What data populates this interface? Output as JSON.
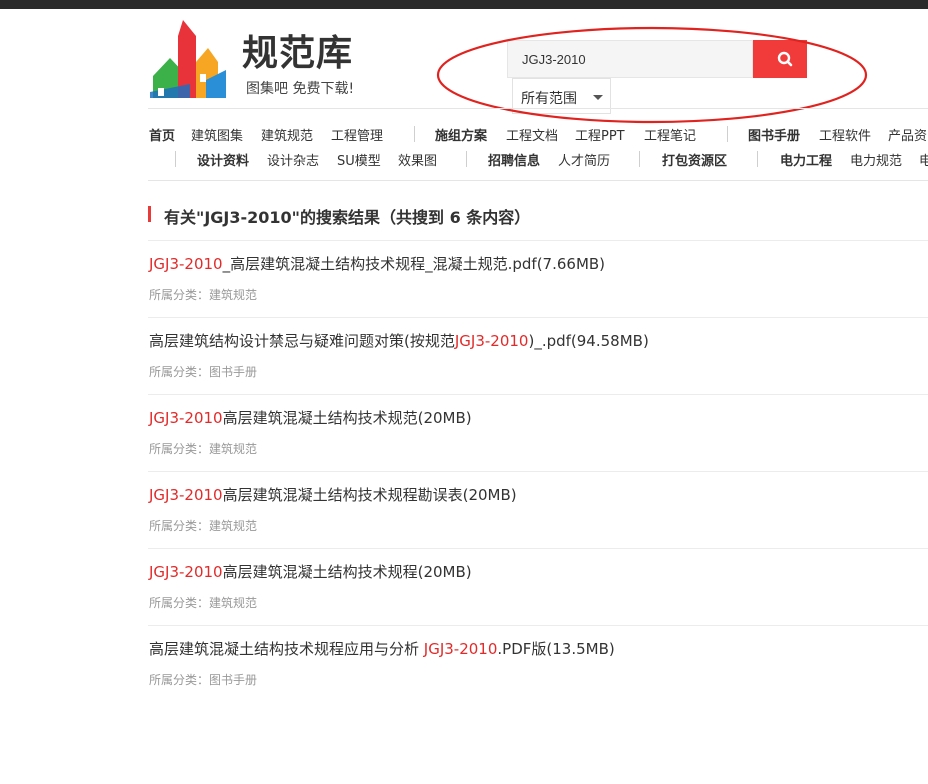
{
  "site": {
    "title": "规范库",
    "slogan": "图集吧 免费下载!"
  },
  "search": {
    "value": "JGJ3-2010",
    "placeholder": "",
    "button_icon": "search-icon",
    "scope_label": "所有范围",
    "accent_color": "#f13a3a"
  },
  "nav": {
    "row1": [
      {
        "label": "首页",
        "bold": true
      },
      {
        "label": "建筑图集",
        "bold": false
      },
      {
        "label": "建筑规范",
        "bold": false
      },
      {
        "label": "工程管理",
        "bold": false
      },
      {
        "label": "施组方案",
        "bold": true
      },
      {
        "label": "工程文档",
        "bold": false
      },
      {
        "label": "工程PPT",
        "bold": false
      },
      {
        "label": "工程笔记",
        "bold": false
      },
      {
        "label": "图书手册",
        "bold": true
      },
      {
        "label": "工程软件",
        "bold": false
      },
      {
        "label": "产品资",
        "bold": false
      }
    ],
    "row2": [
      {
        "label": "设计资料",
        "bold": true
      },
      {
        "label": "设计杂志",
        "bold": false
      },
      {
        "label": "SU模型",
        "bold": false
      },
      {
        "label": "效果图",
        "bold": false
      },
      {
        "label": "招聘信息",
        "bold": true
      },
      {
        "label": "人才简历",
        "bold": false
      },
      {
        "label": "打包资源区",
        "bold": true
      },
      {
        "label": "电力工程",
        "bold": true
      },
      {
        "label": "电力规范",
        "bold": false
      },
      {
        "label": "电",
        "bold": false
      }
    ]
  },
  "results": {
    "heading": "有关\"JGJ3-2010\"的搜索结果（共搜到 6 条内容）",
    "category_prefix": "所属分类：",
    "highlight_color": "#e22a2a",
    "items": [
      {
        "before": "",
        "highlight": "JGJ3-2010",
        "after": "_高层建筑混凝土结构技术规程_混凝土规范.pdf(7.66MB)",
        "category": "建筑规范"
      },
      {
        "before": "高层建筑结构设计禁忌与疑难问题对策(按规范",
        "highlight": "JGJ3-2010",
        "after": ")_.pdf(94.58MB)",
        "category": "图书手册"
      },
      {
        "before": "",
        "highlight": "JGJ3-2010",
        "after": "高层建筑混凝土结构技术规范(20MB)",
        "category": "建筑规范"
      },
      {
        "before": "",
        "highlight": "JGJ3-2010",
        "after": "高层建筑混凝土结构技术规程勘误表(20MB)",
        "category": "建筑规范"
      },
      {
        "before": "",
        "highlight": "JGJ3-2010",
        "after": "高层建筑混凝土结构技术规程(20MB)",
        "category": "建筑规范"
      },
      {
        "before": "高层建筑混凝土结构技术规程应用与分析 ",
        "highlight": "JGJ3-2010",
        "after": ".PDF版(13.5MB)",
        "category": "图书手册"
      }
    ]
  }
}
